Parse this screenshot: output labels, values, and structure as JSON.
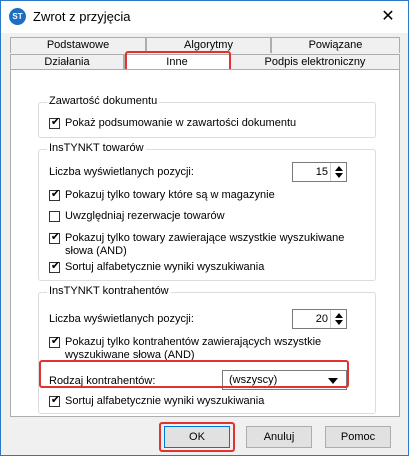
{
  "window": {
    "title": "Zwrot z przyjęcia",
    "icon_text": "ST",
    "close_glyph": "✕"
  },
  "tabs": {
    "row1": [
      "Podstawowe",
      "Algorytmy",
      "Powiązane"
    ],
    "row2": [
      "Działania",
      "Inne",
      "Podpis elektroniczny"
    ],
    "active": "Inne"
  },
  "doc_group": {
    "title": "Zawartość dokumentu",
    "show_summary": {
      "label": "Pokaż podsumowanie w zawartości dokumentu",
      "checked": true
    }
  },
  "towary_group": {
    "title": "InsTYNKT towarów",
    "count_label": "Liczba wyświetlanych pozycji:",
    "count_value": "15",
    "only_in_stock": {
      "label": "Pokazuj tylko towary które są w magazynie",
      "checked": true
    },
    "reservations": {
      "label": "Uwzględniaj rezerwacje towarów",
      "checked": false
    },
    "all_words": {
      "label_line1": "Pokazuj tylko towary zawierające wszystkie wyszukiwane",
      "label_line2": "słowa (AND)",
      "checked": true
    },
    "sort_alpha": {
      "label": "Sortuj alfabetycznie wyniki wyszukiwania",
      "checked": true
    }
  },
  "kontrahenci_group": {
    "title": "InsTYNKT kontrahentów",
    "count_label": "Liczba wyświetlanych pozycji:",
    "count_value": "20",
    "all_words": {
      "label_line1": "Pokazuj tylko kontrahentów zawierających wszystkie",
      "label_line2": "wyszukiwane słowa (AND)",
      "checked": true
    },
    "type_label": "Rodzaj kontrahentów:",
    "type_value": "(wszyscy)",
    "sort_alpha": {
      "label": "Sortuj alfabetycznie wyniki wyszukiwania",
      "checked": true
    }
  },
  "buttons": {
    "ok": "OK",
    "cancel": "Anuluj",
    "help": "Pomoc"
  },
  "check_glyph": "✔",
  "colors": {
    "highlight": "#e0322f",
    "accent": "#0078d7"
  }
}
